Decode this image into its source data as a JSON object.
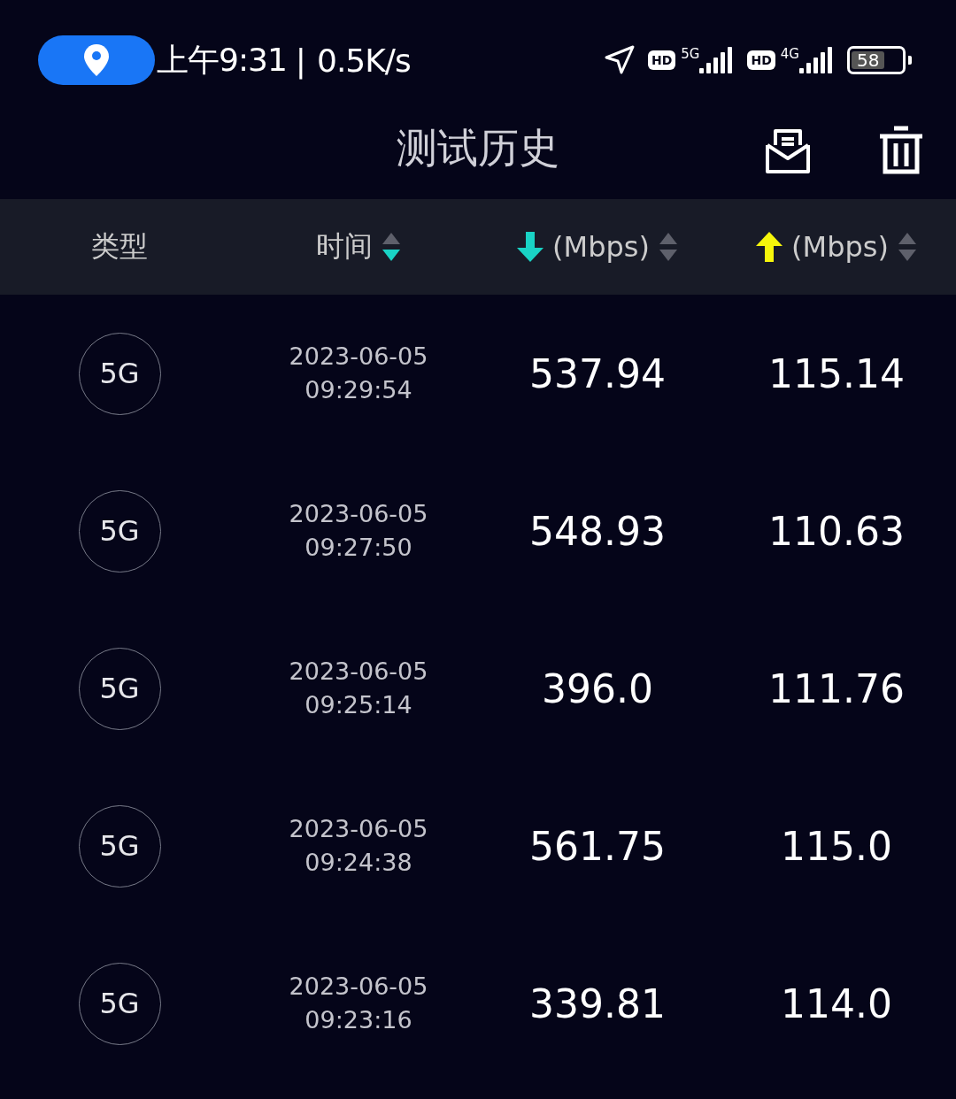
{
  "status_bar": {
    "clock": "上午9:31",
    "separator": "|",
    "speed": "0.5K/s",
    "sim1": {
      "hd": "HD",
      "network": "5G"
    },
    "sim2": {
      "hd": "HD",
      "network": "4G"
    },
    "battery": "58"
  },
  "header": {
    "title": "测试历史"
  },
  "columns": [
    {
      "kind": "type",
      "label": "类型"
    },
    {
      "kind": "time",
      "label": "时间",
      "sort_ascending": false,
      "sort_descending": true
    },
    {
      "kind": "download",
      "label": "(Mbps)",
      "sort_ascending": false,
      "sort_descending": false
    },
    {
      "kind": "upload",
      "label": "(Mbps)",
      "sort_ascending": false,
      "sort_descending": false
    }
  ],
  "rows": [
    {
      "type": "5G",
      "date": "2023-06-05",
      "time": "09:29:54",
      "download": "537.94",
      "upload": "115.14"
    },
    {
      "type": "5G",
      "date": "2023-06-05",
      "time": "09:27:50",
      "download": "548.93",
      "upload": "110.63"
    },
    {
      "type": "5G",
      "date": "2023-06-05",
      "time": "09:25:14",
      "download": "396.0",
      "upload": "111.76"
    },
    {
      "type": "5G",
      "date": "2023-06-05",
      "time": "09:24:38",
      "download": "561.75",
      "upload": "115.0"
    },
    {
      "type": "5G",
      "date": "2023-06-05",
      "time": "09:23:16",
      "download": "339.81",
      "upload": "114.0"
    }
  ]
}
